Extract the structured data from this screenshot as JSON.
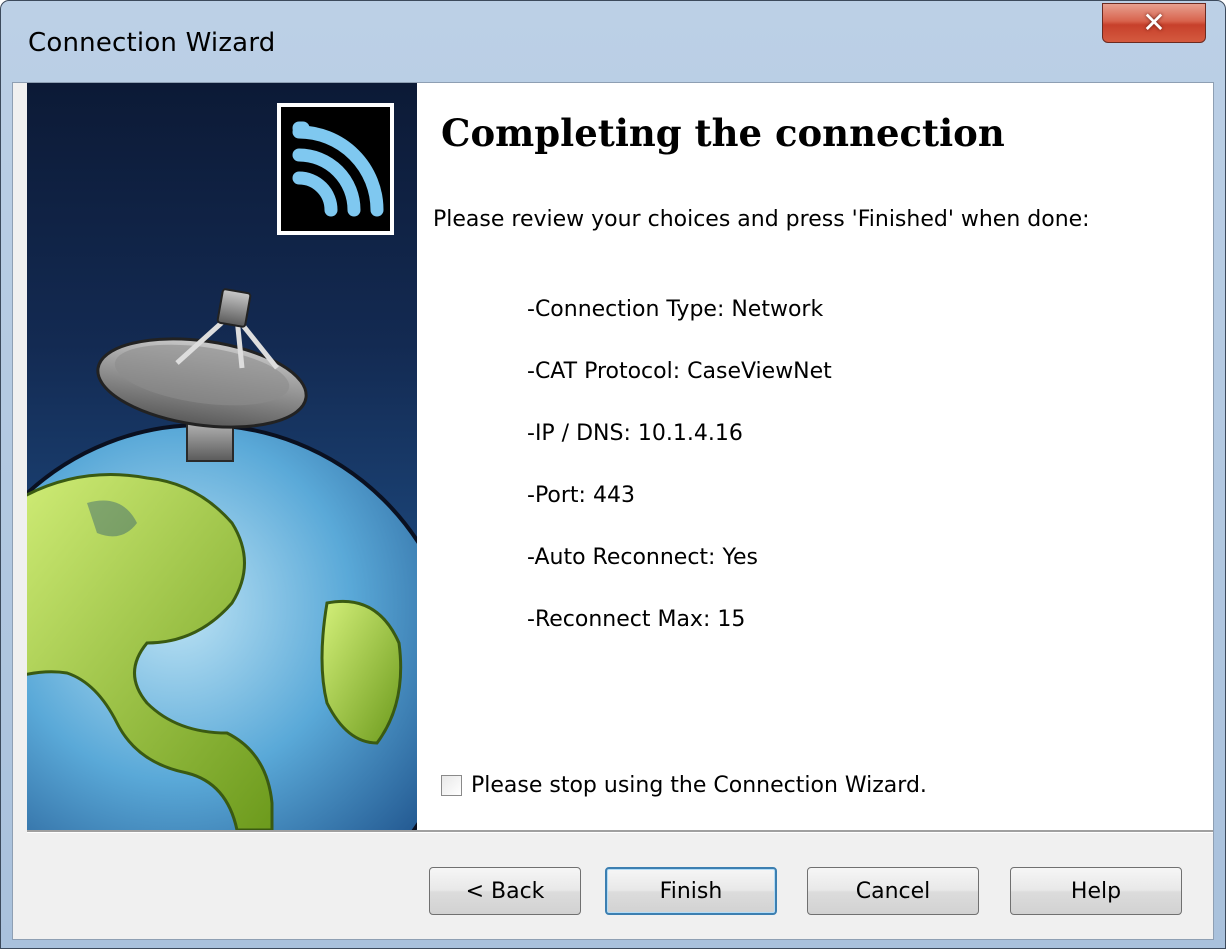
{
  "window": {
    "title": "Connection Wizard"
  },
  "content": {
    "heading": "Completing the connection",
    "instruction": "Please review your choices and press 'Finished' when done:",
    "summary": [
      "-Connection Type: Network",
      "-CAT Protocol: CaseViewNet",
      "-IP / DNS: 10.1.4.16",
      "-Port: 443",
      "-Auto Reconnect: Yes",
      "-Reconnect Max: 15"
    ],
    "stop_checkbox": {
      "label": "Please stop using the Connection Wizard.",
      "checked": false
    }
  },
  "buttons": {
    "back": "< Back",
    "finish": "Finish",
    "cancel": "Cancel",
    "help": "Help"
  },
  "icons": {
    "close": "close-icon",
    "wireless": "wireless-signal-icon",
    "illustration": "satellite-dish-globe-illustration"
  },
  "colors": {
    "accent": "#3c7fb1",
    "close_red": "#c7402b",
    "panel_blue": "#132a52"
  }
}
